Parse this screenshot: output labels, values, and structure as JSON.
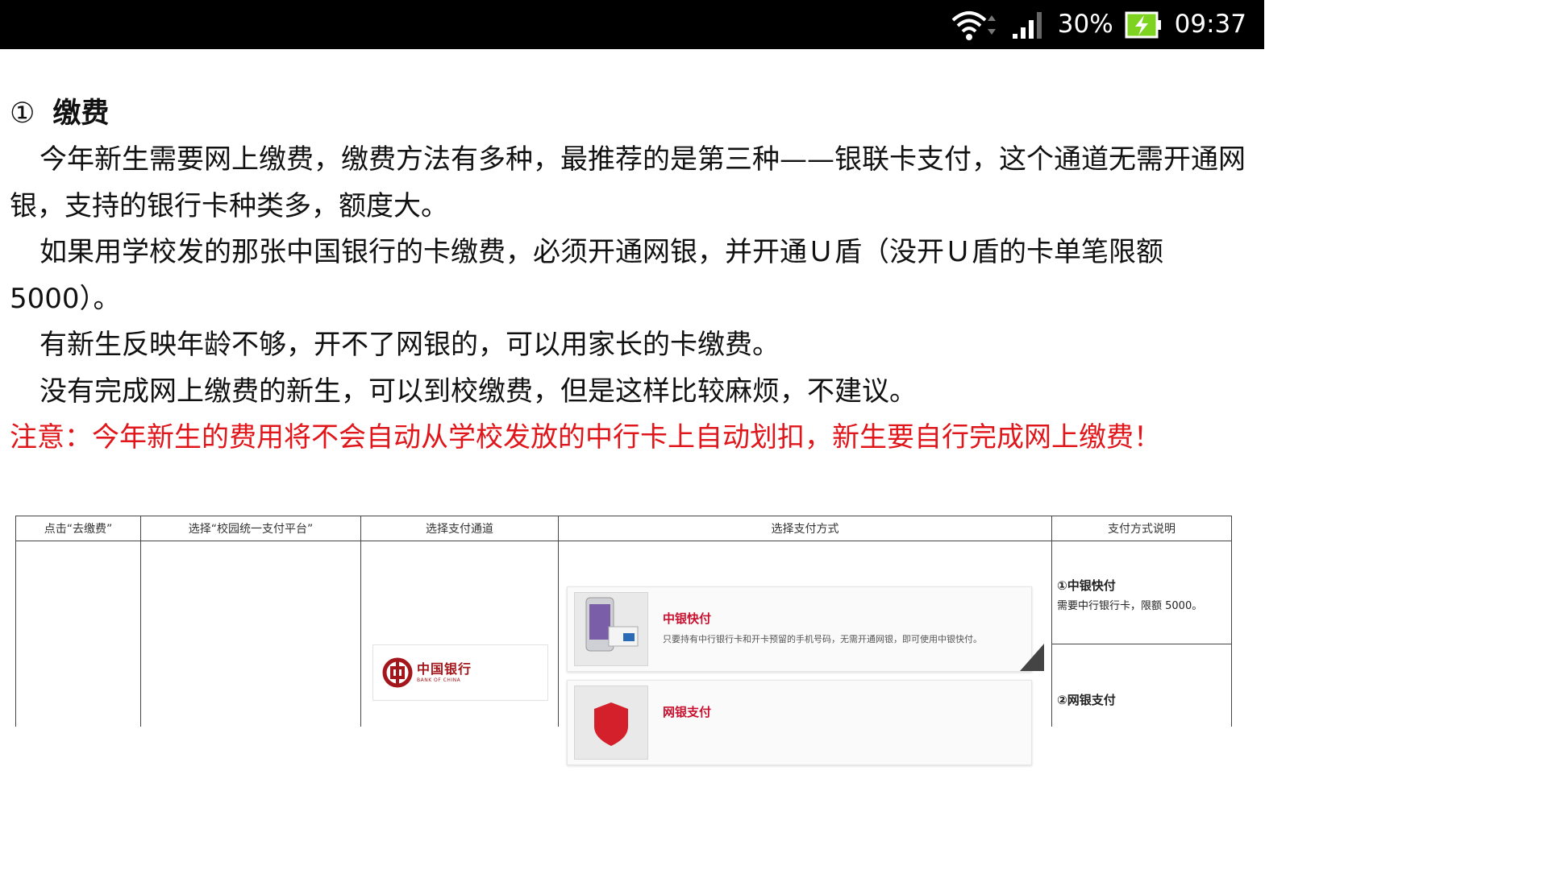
{
  "status_bar": {
    "battery_percent": "30%",
    "time": "09:37"
  },
  "article": {
    "heading_number": "①",
    "heading_title": "缴费",
    "paragraphs": [
      "今年新生需要网上缴费，缴费方法有多种，最推荐的是第三种——银联卡支付，这个通道无需开通网银，支持的银行卡种类多，额度大。",
      "如果用学校发的那张中国银行的卡缴费，必须开通网银，并开通Ｕ盾（没开Ｕ盾的卡单笔限额5000）。",
      "有新生反映年龄不够，开不了网银的，可以用家长的卡缴费。",
      "没有完成网上缴费的新生，可以到校缴费，但是这样比较麻烦，不建议。"
    ],
    "notice": "注意：今年新生的费用将不会自动从学校发放的中行卡上自动划扣，新生要自行完成网上缴费！"
  },
  "flow_table": {
    "headers": [
      "点击“去缴费”",
      "选择“校园统一支付平台”",
      "选择支付通道",
      "选择支付方式",
      "支付方式说明"
    ],
    "bank_logo": {
      "name": "中国银行",
      "english": "BANK OF CHINA"
    },
    "pay_options": [
      {
        "title": "中银快付",
        "desc": "只要持有中行银行卡和开卡预留的手机号码，无需开通网银，即可使用中银快付。"
      },
      {
        "title": "网银支付",
        "desc": ""
      }
    ],
    "notes": [
      {
        "title": "①中银快付",
        "desc": "需要中行银行卡，限额 5000。"
      },
      {
        "title": "②网银支付",
        "desc": ""
      }
    ]
  },
  "colors": {
    "notice_red": "#e0161b",
    "boc_red": "#a3161b",
    "pay_title_red": "#c8102e",
    "battery_green": "#7ed321"
  }
}
